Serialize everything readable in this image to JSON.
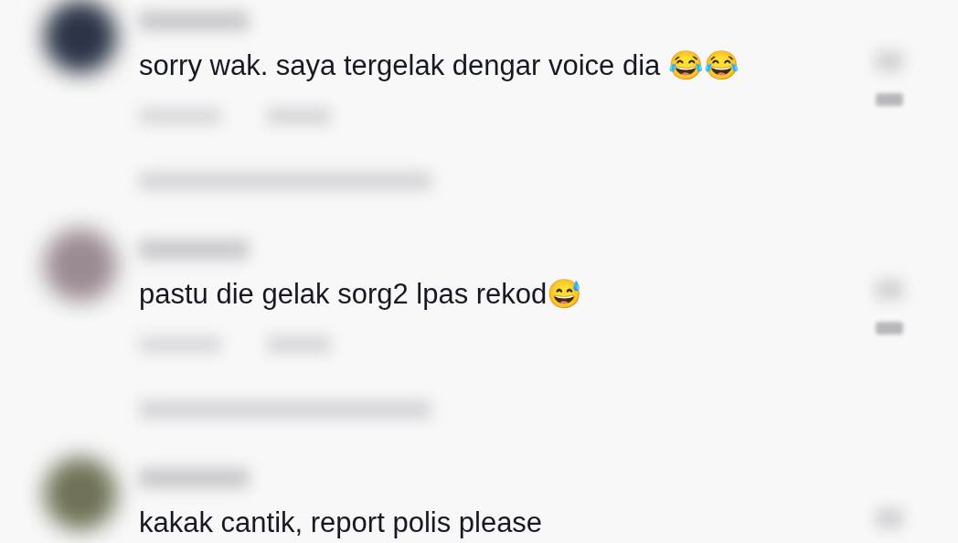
{
  "comments": [
    {
      "text": "sorry wak. saya tergelak dengar voice dia 😂😂"
    },
    {
      "text": "pastu die gelak sorg2 lpas rekod😅"
    },
    {
      "text": "kakak cantik, report polis please"
    }
  ]
}
